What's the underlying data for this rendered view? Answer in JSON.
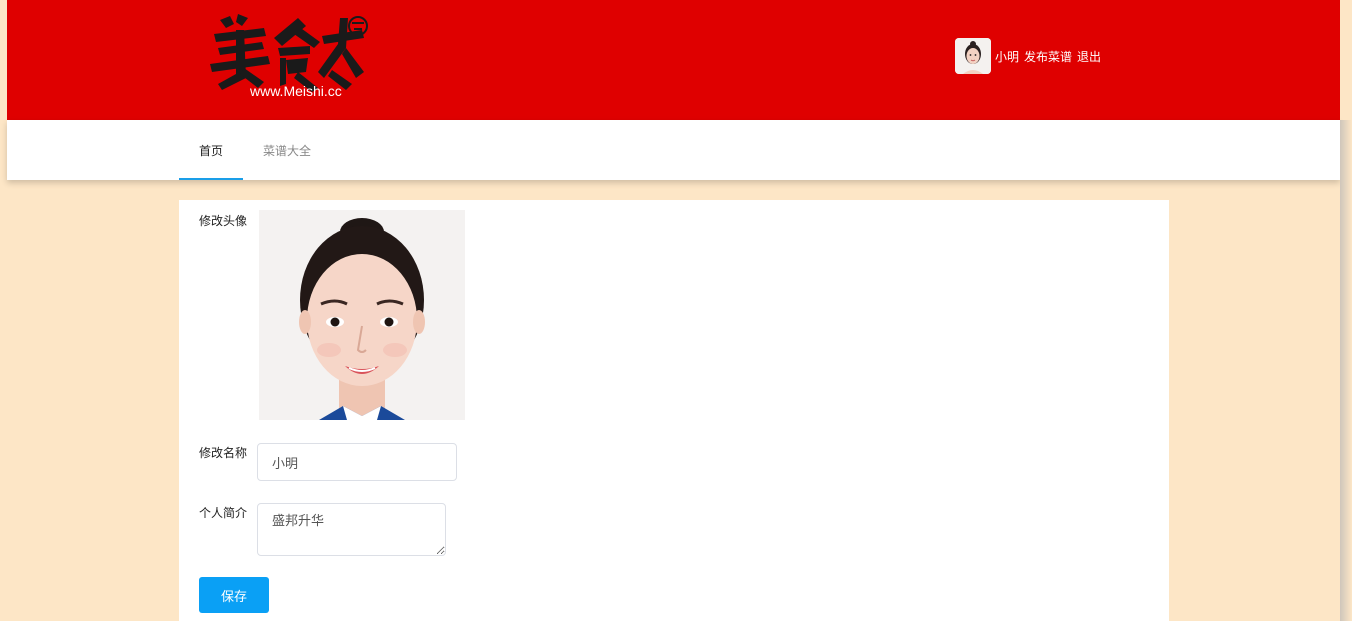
{
  "header": {
    "logo": {
      "brand_text": "美食杰",
      "url_text": "www.Meishi.cc",
      "seal_text": "美食"
    },
    "user": {
      "avatar_icon": "user-avatar-photo",
      "name": "小明",
      "publish_label": "发布菜谱",
      "logout_label": "退出"
    },
    "colors": {
      "header_bg": "#df0000"
    }
  },
  "nav": {
    "tabs": [
      {
        "label": "首页",
        "active": true
      },
      {
        "label": "菜谱大全",
        "active": false
      }
    ],
    "accent": "#1a9ee8"
  },
  "form": {
    "avatar_label": "修改头像",
    "avatar_icon": "profile-photo",
    "name_label": "修改名称",
    "name_value": "小明",
    "bio_label": "个人简介",
    "bio_value": "盛邦升华",
    "save_label": "保存",
    "save_color": "#0aa0f5"
  },
  "page": {
    "background": "#fde6c6"
  }
}
